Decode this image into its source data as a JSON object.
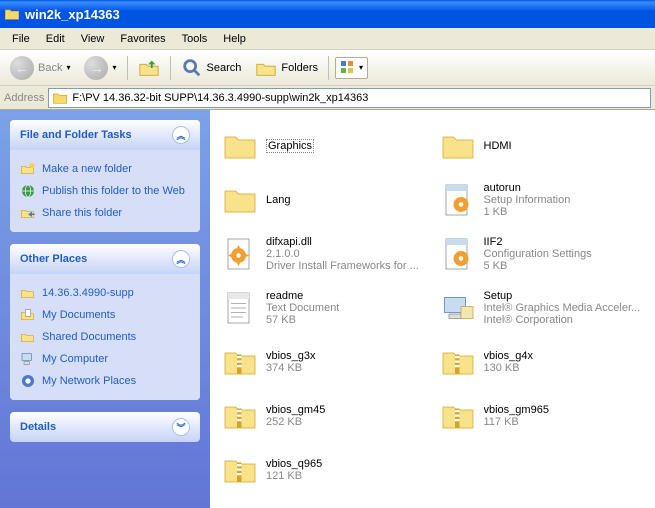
{
  "window": {
    "title": "win2k_xp14363"
  },
  "menu": {
    "file": "File",
    "edit": "Edit",
    "view": "View",
    "favorites": "Favorites",
    "tools": "Tools",
    "help": "Help"
  },
  "toolbar": {
    "back": "Back",
    "search": "Search",
    "folders": "Folders"
  },
  "address": {
    "label": "Address",
    "path": "F:\\PV 14.36.32-bit SUPP\\14.36.3.4990-supp\\win2k_xp14363"
  },
  "sidebar": {
    "tasks": {
      "title": "File and Folder Tasks",
      "items": [
        {
          "label": "Make a new folder"
        },
        {
          "label": "Publish this folder to the Web"
        },
        {
          "label": "Share this folder"
        }
      ]
    },
    "places": {
      "title": "Other Places",
      "items": [
        {
          "label": "14.36.3.4990-supp"
        },
        {
          "label": "My Documents"
        },
        {
          "label": "Shared Documents"
        },
        {
          "label": "My Computer"
        },
        {
          "label": "My Network Places"
        }
      ]
    },
    "details": {
      "title": "Details"
    }
  },
  "files": [
    {
      "name": "Graphics",
      "type": "folder",
      "selected": true
    },
    {
      "name": "HDMI",
      "type": "folder"
    },
    {
      "name": "Lang",
      "type": "folder"
    },
    {
      "name": "autorun",
      "line2": "Setup Information",
      "line3": "1 KB",
      "type": "inf"
    },
    {
      "name": "difxapi.dll",
      "line2": "2.1.0.0",
      "line3": "Driver Install Frameworks for ...",
      "type": "dll"
    },
    {
      "name": "IIF2",
      "line2": "Configuration Settings",
      "line3": "5 KB",
      "type": "ini"
    },
    {
      "name": "readme",
      "line2": "Text Document",
      "line3": "57 KB",
      "type": "txt"
    },
    {
      "name": "Setup",
      "line2": "Intel® Graphics Media Acceler...",
      "line3": "Intel® Corporation",
      "type": "setup"
    },
    {
      "name": "vbios_g3x",
      "line2": "374 KB",
      "type": "zip"
    },
    {
      "name": "vbios_g4x",
      "line2": "130 KB",
      "type": "zip"
    },
    {
      "name": "vbios_gm45",
      "line2": "252 KB",
      "type": "zip"
    },
    {
      "name": "vbios_gm965",
      "line2": "117 KB",
      "type": "zip"
    },
    {
      "name": "vbios_q965",
      "line2": "121 KB",
      "type": "zip"
    }
  ]
}
